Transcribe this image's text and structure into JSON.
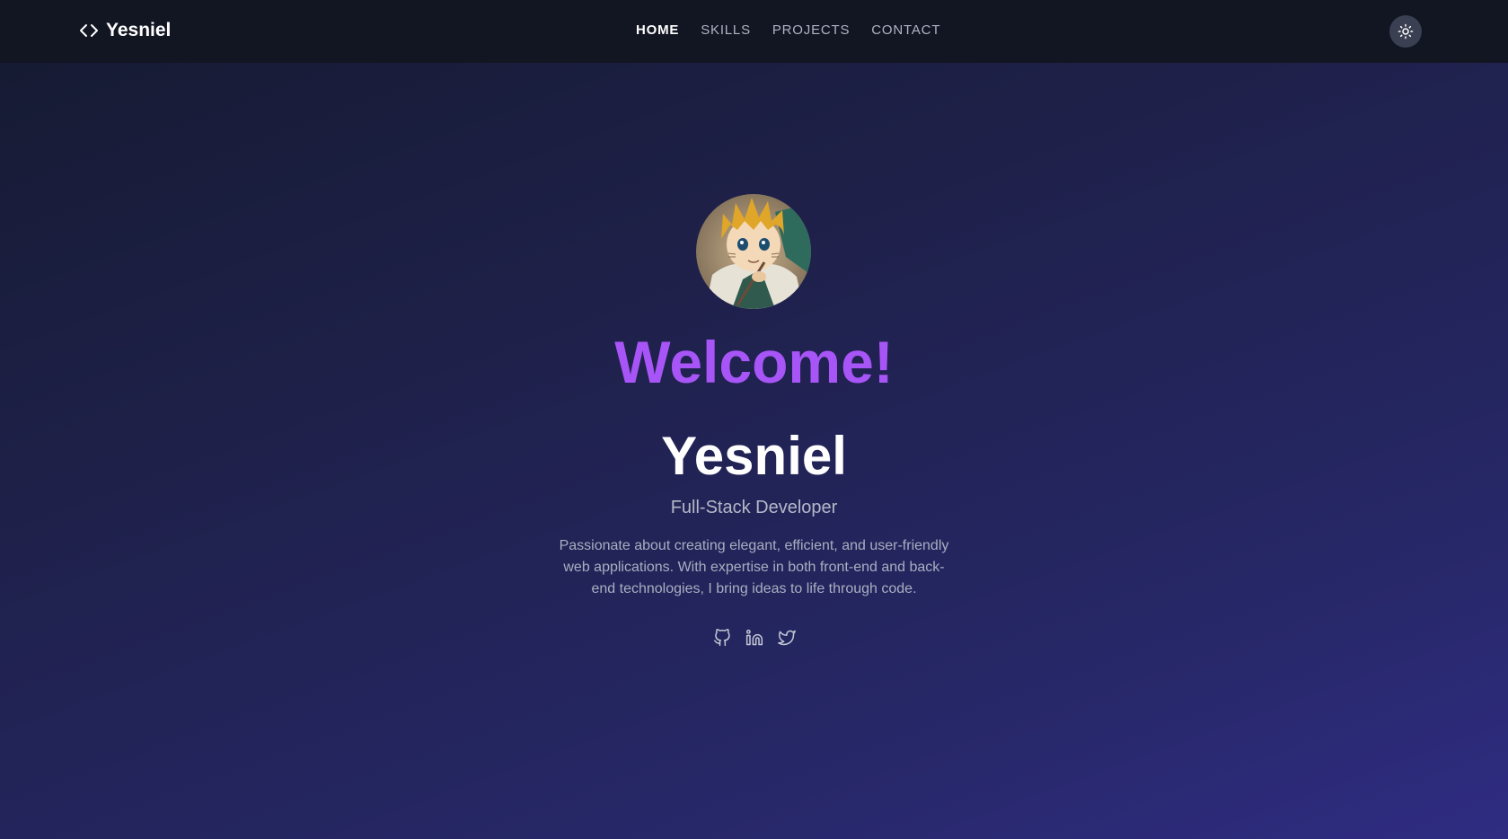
{
  "brand": {
    "name": "Yesniel",
    "icon": "code-brackets-icon"
  },
  "nav": {
    "items": [
      {
        "label": "HOME",
        "active": true
      },
      {
        "label": "SKILLS",
        "active": false
      },
      {
        "label": "PROJECTS",
        "active": false
      },
      {
        "label": "CONTACT",
        "active": false
      }
    ],
    "theme_toggle_icon": "sun-icon"
  },
  "hero": {
    "avatar_icon": "anime-avatar",
    "welcome": "Welcome!",
    "name": "Yesniel",
    "role": "Full-Stack Developer",
    "bio": "Passionate about creating elegant, efficient, and user-friendly web applications. With expertise in both front-end and back-end technologies, I bring ideas to life through code.",
    "socials": [
      {
        "icon": "github-icon"
      },
      {
        "icon": "linkedin-icon"
      },
      {
        "icon": "twitter-icon"
      }
    ]
  },
  "colors": {
    "accent": "#a855f7",
    "navbar_bg": "#121623",
    "text_primary": "#ffffff",
    "text_muted": "#a9aec0"
  }
}
